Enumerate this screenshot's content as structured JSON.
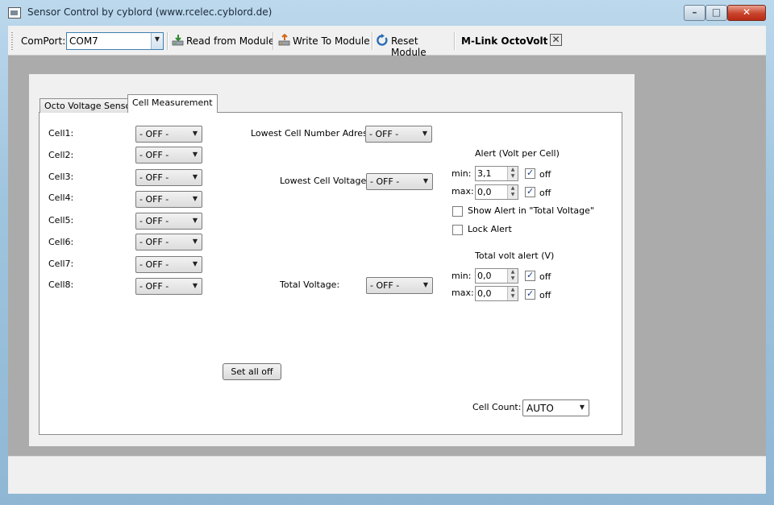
{
  "window": {
    "title": "Sensor Control by cyblord (www.rcelec.cyblord.de)",
    "minimize_glyph": "–",
    "maximize_glyph": "□",
    "close_glyph": "✕"
  },
  "toolbar": {
    "comport_label": "ComPort:",
    "comport_value": "COM7",
    "read_label": "Read from Module",
    "write_label": "Write To Module",
    "reset_label": "Reset Module",
    "module_name": "M-Link OctoVolt",
    "close_glyph": "✕",
    "icons": [
      "read-module-icon",
      "write-module-icon",
      "reset-module-icon",
      "close-icon"
    ]
  },
  "tabs": [
    {
      "label": "Octo Voltage Sensor",
      "active": false
    },
    {
      "label": "Cell Measurement",
      "active": true
    }
  ],
  "cells": [
    {
      "label": "Cell1:",
      "value": "- OFF -"
    },
    {
      "label": "Cell2:",
      "value": "- OFF -"
    },
    {
      "label": "Cell3:",
      "value": "- OFF -"
    },
    {
      "label": "Cell4:",
      "value": "- OFF -"
    },
    {
      "label": "Cell5:",
      "value": "- OFF -"
    },
    {
      "label": "Cell6:",
      "value": "- OFF -"
    },
    {
      "label": "Cell7:",
      "value": "- OFF -"
    },
    {
      "label": "Cell8:",
      "value": "- OFF -"
    }
  ],
  "middle": {
    "lowest_cell_number_label": "Lowest Cell Number Adress:",
    "lowest_cell_number_value": "- OFF -",
    "lowest_cell_voltage_label": "Lowest Cell Voltage:",
    "lowest_cell_voltage_value": "- OFF -",
    "total_voltage_label": "Total Voltage:",
    "total_voltage_value": "- OFF -",
    "set_all_off_label": "Set all off"
  },
  "alert": {
    "title": "Alert (Volt per Cell)",
    "min_label": "min:",
    "min_value": "3,1",
    "min_off_label": "off",
    "min_off_checked": true,
    "max_label": "max:",
    "max_value": "0,0",
    "max_off_label": "off",
    "max_off_checked": true,
    "show_alert_label": "Show Alert in \"Total Voltage\"",
    "show_alert_checked": false,
    "lock_alert_label": "Lock Alert",
    "lock_alert_checked": false
  },
  "total_alert": {
    "title": "Total volt alert (V)",
    "min_label": "min:",
    "min_value": "0,0",
    "min_off_label": "off",
    "min_off_checked": true,
    "max_label": "max:",
    "max_value": "0,0",
    "max_off_label": "off",
    "max_off_checked": true
  },
  "cell_count": {
    "label": "Cell Count:",
    "value": "AUTO"
  },
  "colors": {
    "title_bar": "#9fc4de",
    "close_button": "#c8432b",
    "client_background": "#ababab",
    "panel_background": "#f0f0f0"
  }
}
